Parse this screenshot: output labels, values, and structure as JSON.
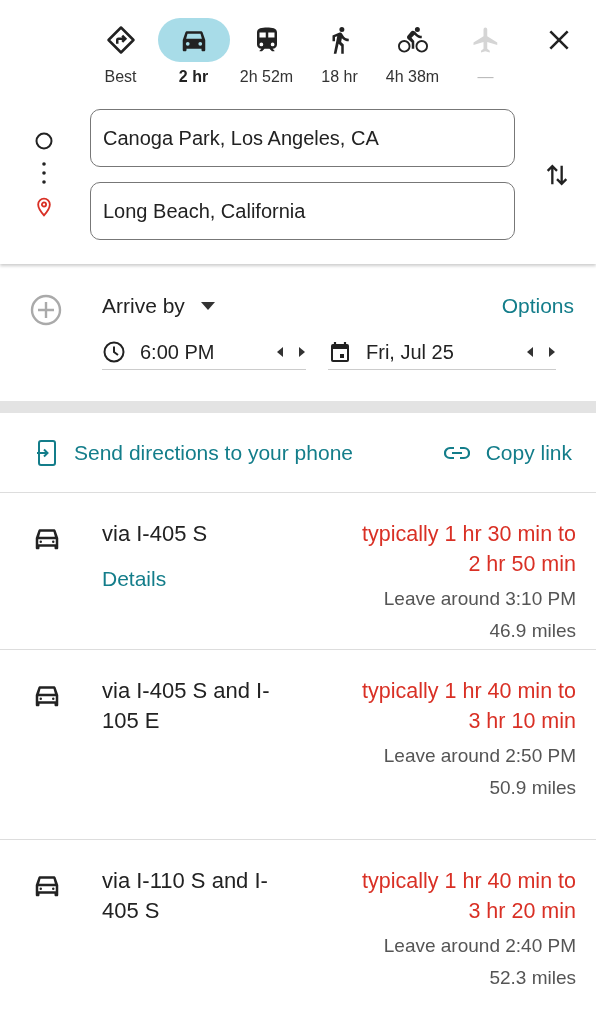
{
  "modes": [
    {
      "kind": "best",
      "label": "Best",
      "selected": false,
      "disabled": false
    },
    {
      "kind": "car",
      "label": "2 hr",
      "selected": true,
      "disabled": false
    },
    {
      "kind": "transit",
      "label": "2h 52m",
      "selected": false,
      "disabled": false
    },
    {
      "kind": "walk",
      "label": "18 hr",
      "selected": false,
      "disabled": false
    },
    {
      "kind": "bike",
      "label": "4h 38m",
      "selected": false,
      "disabled": false
    },
    {
      "kind": "flight",
      "label": "—",
      "selected": false,
      "disabled": true
    }
  ],
  "origin": {
    "value": "Canoga Park, Los Angeles, CA"
  },
  "destination": {
    "value": "Long Beach, California"
  },
  "timing": {
    "mode": "Arrive by",
    "options": "Options",
    "time": "6:00 PM",
    "date": "Fri, Jul 25"
  },
  "share": {
    "send": "Send directions to your phone",
    "copy": "Copy link"
  },
  "routes": [
    {
      "name": "via I-405 S",
      "details": "Details",
      "duration": "typically 1 hr 30 min to 2 hr 50 min",
      "leave": "Leave around 3:10 PM",
      "distance": "46.9 miles"
    },
    {
      "name": "via I-405 S and I-105 E",
      "duration": "typically 1 hr 40 min to 3 hr 10 min",
      "leave": "Leave around 2:50 PM",
      "distance": "50.9 miles"
    },
    {
      "name": "via I-110 S and I-405 S",
      "duration": "typically 1 hr 40 min to 3 hr 20 min",
      "leave": "Leave around 2:40 PM",
      "distance": "52.3 miles"
    }
  ]
}
